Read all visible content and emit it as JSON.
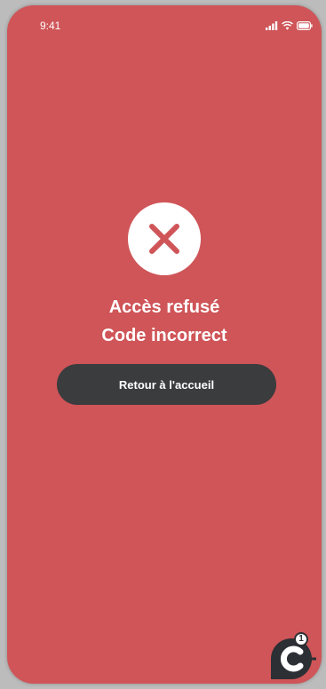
{
  "status_bar": {
    "time": "9:41"
  },
  "result": {
    "title": "Accès refusé",
    "subtitle": "Code incorrect",
    "icon": "close-icon"
  },
  "actions": {
    "back_home_label": "Retour à l'accueil"
  },
  "chat_widget": {
    "icon": "chat-icon",
    "badge_count": "1"
  },
  "colors": {
    "background": "#cf5558",
    "button": "#3a3c3e",
    "error_icon": "#cf5558",
    "text": "#ffffff"
  }
}
